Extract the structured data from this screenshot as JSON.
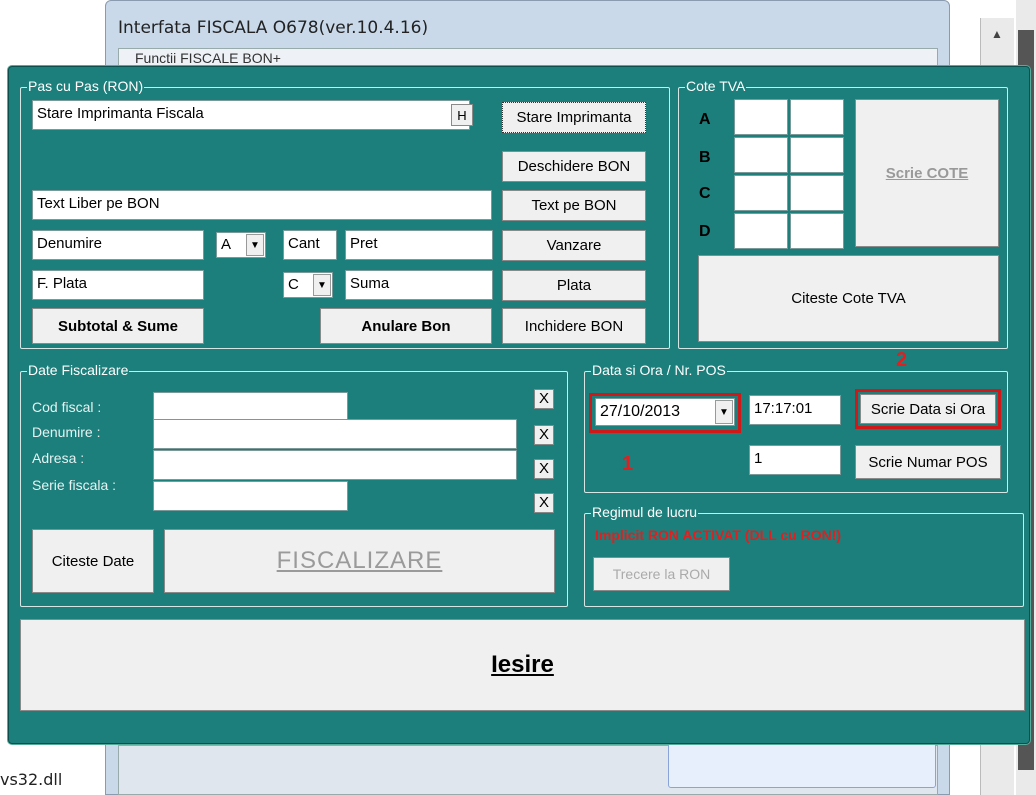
{
  "background_window": {
    "title": "Interfata FISCALA  O678(ver.10.4.16)",
    "tab_label": "Functii FISCALE BON+",
    "left_text": "vs32.dll",
    "scroll_up_icon": "▲"
  },
  "pas_cu_pas": {
    "legend": "Pas cu Pas (RON)",
    "stare_field": "Stare Imprimanta Fiscala",
    "h_button": "H",
    "stare_button": "Stare Imprimanta",
    "deschidere_button": "Deschidere BON",
    "text_liber_field": "Text Liber pe BON",
    "text_bon_button": "Text pe BON",
    "denumire_field": "Denumire",
    "vat_select": "A",
    "cant_field": "Cant",
    "pret_field": "Pret",
    "vanzare_button": "Vanzare",
    "plata_field": "F. Plata",
    "plata_select": "C",
    "suma_field": "Suma",
    "plata_button": "Plata",
    "subtotal_button": "Subtotal & Sume",
    "anulare_button": "Anulare Bon",
    "inchidere_button": "Inchidere BON"
  },
  "cote_tva": {
    "legend": "Cote TVA",
    "labels": [
      "A",
      "B",
      "C",
      "D"
    ],
    "scrie_button": "Scrie COTE",
    "citeste_button": "Citeste Cote TVA"
  },
  "date_fiscalizare": {
    "legend": "Date Fiscalizare",
    "cod_fiscal": "Cod fiscal :",
    "denumire": "Denumire :",
    "adresa": "Adresa :",
    "serie_fiscala": "Serie fiscala :",
    "clear_icon": "X",
    "citeste_button": "Citeste Date",
    "fiscalizare_button": "FISCALIZARE"
  },
  "data_ora": {
    "legend": "Data si Ora / Nr. POS",
    "date_value": "27/10/2013",
    "time_value": "17:17:01",
    "scrie_data_button": "Scrie Data si Ora",
    "pos_value": "1",
    "scrie_pos_button": "Scrie Numar POS",
    "annotation_1": "1",
    "annotation_2": "2",
    "accent_red": "#d01818"
  },
  "regim": {
    "legend": "Regimul de lucru",
    "status": "Implicit RON ACTIVAT (DLL cu RON!)",
    "trecere_button": "Trecere la RON"
  },
  "iesire_button": "Iesire",
  "colors": {
    "dialog_bg": "#1c7f7b"
  }
}
